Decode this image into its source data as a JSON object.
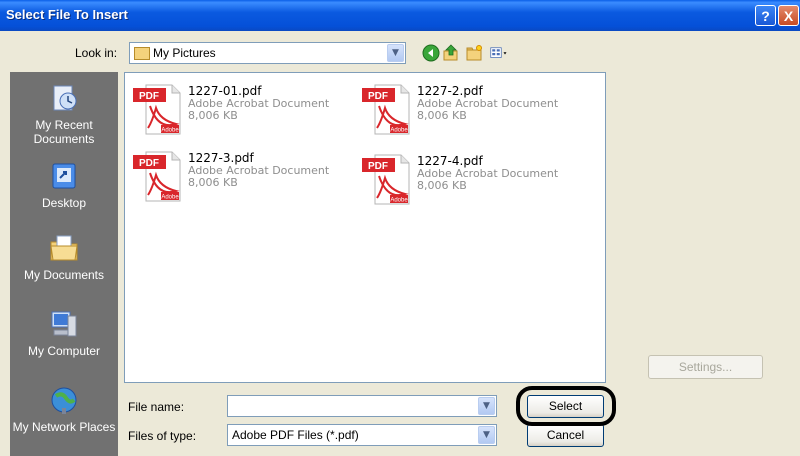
{
  "window": {
    "title": "Select File To Insert",
    "help_label": "?",
    "close_label": "X"
  },
  "lookin": {
    "label": "Look in:",
    "value": "My Pictures"
  },
  "toolbar": {
    "icons": [
      "back-icon",
      "up-folder-icon",
      "new-folder-icon",
      "views-menu-icon"
    ]
  },
  "places": [
    {
      "label": "My Recent Documents",
      "icon": "recent-documents-icon"
    },
    {
      "label": "Desktop",
      "icon": "desktop-icon"
    },
    {
      "label": "My Documents",
      "icon": "my-documents-icon"
    },
    {
      "label": "My Computer",
      "icon": "my-computer-icon"
    },
    {
      "label": "My Network Places",
      "icon": "network-places-icon"
    }
  ],
  "files": [
    {
      "name": "1227-01.pdf",
      "type": "Adobe Acrobat Document",
      "size": "8,006 KB"
    },
    {
      "name": "1227-2.pdf",
      "type": "Adobe Acrobat Document",
      "size": "8,006 KB"
    },
    {
      "name": "1227-3.pdf",
      "type": "Adobe Acrobat Document",
      "size": "8,006 KB"
    },
    {
      "name": "1227-4.pdf",
      "type": "Adobe Acrobat Document",
      "size": "8,006 KB"
    }
  ],
  "pdf_badge": "PDF",
  "pdf_brand": "Adobe",
  "settings_label": "Settings...",
  "filename": {
    "label": "File name:",
    "value": "",
    "placeholder": ""
  },
  "filetype": {
    "label": "Files of type:",
    "value": "Adobe PDF Files (*.pdf)"
  },
  "buttons": {
    "select": "Select",
    "cancel": "Cancel"
  },
  "colors": {
    "titlebar": "#0550d8",
    "places_bar": "#717171",
    "pdf_red": "#d9262b"
  }
}
